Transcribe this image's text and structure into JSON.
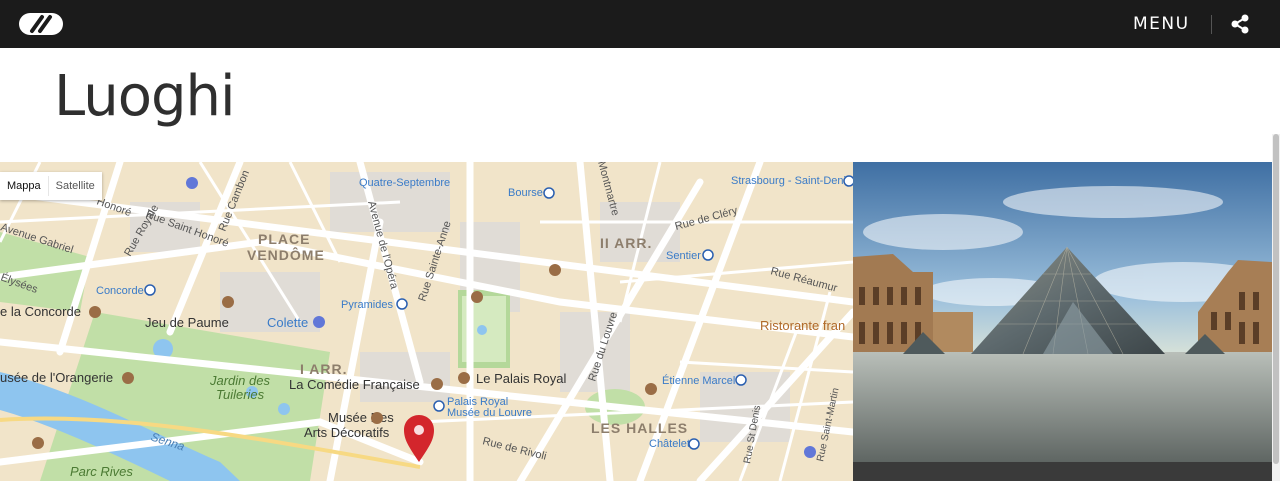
{
  "header": {
    "menu_label": "MENU",
    "logo_icon": "chain-link-logo-icon",
    "share_icon": "share-icon"
  },
  "page": {
    "title": "Luoghi"
  },
  "map": {
    "type_options": [
      "Mappa",
      "Satellite"
    ],
    "labels": {
      "place_vendome_1": "PLACE",
      "place_vendome_2": "VENDÔME",
      "ii_arr": "II ARR.",
      "i_arr": "I ARR.",
      "les_halles": "LES HALLES",
      "quatre_septembre": "Quatre-Septembre",
      "bourse": "Bourse",
      "strasbourg": "Strasbourg - Saint-Denis",
      "rue_de_clery": "Rue de Cléry",
      "sentier": "Sentier",
      "rue_reaumur": "Rue Réaumur",
      "ristorante": "Ristorante fran",
      "etienne_marcel": "Étienne Marcel",
      "chatelet": "Châtelet",
      "rue_st_denis": "Rue St Denis",
      "rue_saint_martin": "Rue Saint-Martin",
      "rue_du_louvre": "Rue du Louvre",
      "montmartre": "Montmartre",
      "avenue_opera": "Avenue de l'Opéra",
      "rue_sainte_anne": "Rue Sainte-Anne",
      "pyramides": "Pyramides",
      "colette": "Colette",
      "le_palais_royal": "Le Palais Royal",
      "palais_royal_1": "Palais Royal",
      "palais_royal_2": "Musée du Louvre",
      "comedie": "La Comédie Française",
      "musee_des_1": "Musée Des",
      "musee_des_2": "Arts Décoratifs",
      "rue_de_rivoli": "Rue de Rivoli",
      "jeu_de_paume": "Jeu de Paume",
      "concorde": "Concorde",
      "place_concorde": "e la Concorde",
      "orangerie": "usée de l'Orangerie",
      "jardin_1": "Jardin des",
      "jardin_2": "Tuileries",
      "senna": "Senna",
      "parc_rives": "Parc Rives",
      "rue_royale": "Rue Royale",
      "rue_cambon": "Rue Cambon",
      "rue_saint_honore": "Rue Saint Honoré",
      "honore": "Honoré",
      "avenue_gabriel": "Avenue Gabriel",
      "elysees": "Élysées"
    },
    "marker_icon": "map-pin-icon"
  },
  "photo": {
    "subject_icon": "louvre-pyramid-photo"
  },
  "colors": {
    "header_bg": "#1b1b1b",
    "map_land": "#f2e6cf",
    "map_road": "#ffffff",
    "map_park": "#b9dba0",
    "map_water": "#8cc4f0",
    "marker": "#d3262c"
  }
}
